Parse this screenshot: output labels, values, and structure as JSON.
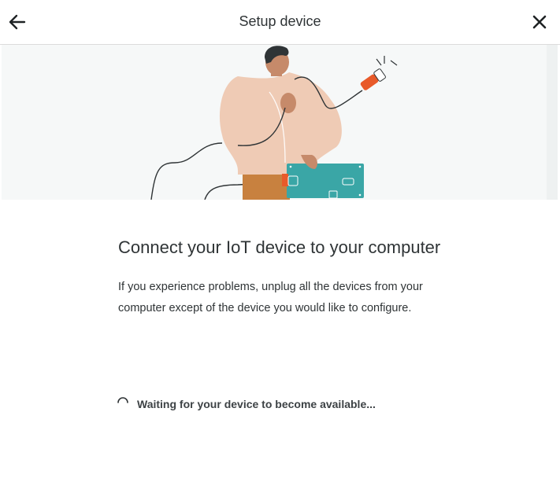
{
  "header": {
    "title": "Setup device",
    "back_icon": "arrow-left-icon",
    "close_icon": "close-icon"
  },
  "illustration": {
    "name": "person-plugging-cable-into-board",
    "colors": {
      "cable_plug": "#e85a2a",
      "board": "#3aa6a6",
      "sweater": "#efcbb5",
      "skin": "#c68a6a",
      "hair": "#2f3436",
      "pants": "#c8813f"
    }
  },
  "main": {
    "heading": "Connect your IoT device to your computer",
    "description": "If you experience problems, unplug all the devices from your computer except of the device you would like to configure."
  },
  "status": {
    "icon": "spinner-icon",
    "text": "Waiting for your device to become available..."
  }
}
